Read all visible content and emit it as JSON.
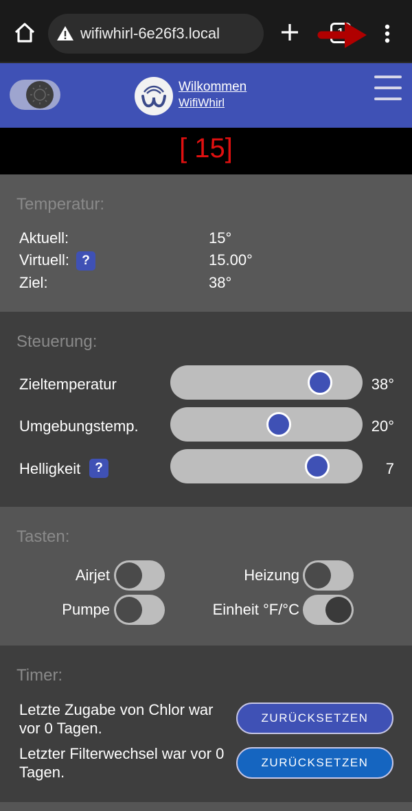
{
  "browser": {
    "url": "wifiwhirl-6e26f3.local",
    "tab_count": "1"
  },
  "header": {
    "title": "Wilkommen",
    "subtitle": "WifiWhirl"
  },
  "counter": "[ 15]",
  "temperature": {
    "title": "Temperatur:",
    "rows": [
      {
        "label": "Aktuell:",
        "value": "15°"
      },
      {
        "label": "Virtuell:",
        "value": "15.00°",
        "help": "?"
      },
      {
        "label": "Ziel:",
        "value": "38°"
      }
    ]
  },
  "control": {
    "title": "Steuerung:",
    "sliders": [
      {
        "label": "Zieltemperatur",
        "value_text": "38°",
        "fraction": 0.84
      },
      {
        "label": "Umgebungstemp.",
        "value_text": "20°",
        "fraction": 0.58
      },
      {
        "label": "Helligkeit",
        "value_text": "7",
        "fraction": 0.82,
        "help": "?"
      }
    ]
  },
  "keys": {
    "title": "Tasten:",
    "switches": [
      {
        "label": "Airjet",
        "on": false
      },
      {
        "label": "Heizung",
        "on": false
      },
      {
        "label": "Pumpe",
        "on": false
      },
      {
        "label": "Einheit °F/°C",
        "on": true
      }
    ]
  },
  "timer": {
    "title": "Timer:",
    "rows": [
      {
        "text": "Letzte Zugabe von Chlor war vor 0 Tagen.",
        "button": "ZURÜCKSETZEN"
      },
      {
        "text": "Letzter Filterwechsel war vor 0 Tagen.",
        "button": "ZURÜCKSETZEN"
      }
    ]
  },
  "colors": {
    "header_bg": "#3f51b5",
    "counter_text": "#e01010",
    "button_primary": "#3f51b5",
    "button_secondary": "#1565c0",
    "arrow": "#b00000"
  },
  "icons": [
    "home-icon",
    "warning-icon",
    "plus-icon",
    "tabs-icon",
    "red-arrow-icon",
    "more-vert-icon",
    "logo-icon",
    "hamburger-menu-icon",
    "help-icon"
  ]
}
